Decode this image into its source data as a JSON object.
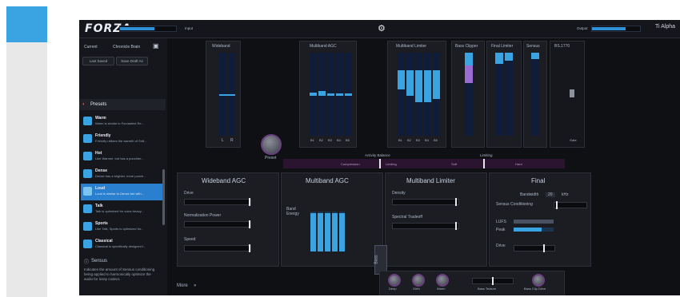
{
  "app": {
    "logo": "FORZA",
    "brand": "Ti Alpha",
    "input_label": "Input",
    "output_label": "Output",
    "input_level": 0.62,
    "output_level": 0.7
  },
  "sidebar": {
    "current_label": "Current",
    "current_value": "Chronicle Brain",
    "chips": [
      "Last Saved",
      "Save Draft As"
    ],
    "presets_label": "Presets",
    "presets": [
      {
        "title": "Warm",
        "desc": "Warm is similar to Forzastrict Re..."
      },
      {
        "title": "Friendly",
        "desc": "Friendly utilizes the warmth of Soft..."
      },
      {
        "title": "Hot",
        "desc": "Like Warmer, but has a punchier..."
      },
      {
        "title": "Dense",
        "desc": "Dense has a brighter, more punch..."
      },
      {
        "title": "Loud",
        "desc": "Loud is similar to Dense but with..."
      },
      {
        "title": "Talk",
        "desc": "Talk is optimized for voice-heavy..."
      },
      {
        "title": "Sports",
        "desc": "Like Talk, Sports is optimized for..."
      },
      {
        "title": "Classical",
        "desc": "Classical is specifically designed f..."
      }
    ],
    "selected_index": 4,
    "sensus_title": "Sensus",
    "sensus_desc": "Indicates the amount of Sensus conditioning being applied to harmonically optimize the audio for lossy codecs."
  },
  "meters": {
    "wideband": {
      "title": "Wideband",
      "labels": [
        "L",
        "R"
      ]
    },
    "multiband_agc": {
      "title": "Multiband AGC",
      "labels": [
        "B1",
        "B2",
        "B3",
        "B4",
        "B5"
      ]
    },
    "multiband_limiter": {
      "title": "Multiband Limiter",
      "labels": [
        "B1",
        "B2",
        "B3",
        "B4",
        "B5"
      ]
    },
    "bass_clipper": {
      "title": "Bass Clipper"
    },
    "final_limiter": {
      "title": "Final Limiter"
    },
    "sensus": {
      "title": "Sensus"
    },
    "bs1770": {
      "title": "BS.1770",
      "gate": "Gate"
    }
  },
  "center": {
    "preset_knob_label": "Preset",
    "activity_balance": "Activity Balance",
    "limiting": "Limiting",
    "compression": "Compression",
    "limiting2": "Limiting",
    "soft": "Soft",
    "hard": "Hard"
  },
  "sections": {
    "wideband_agc": {
      "title": "Wideband AGC",
      "drive": "Drive",
      "norm": "Normalization Power",
      "speed": "Speed"
    },
    "multiband_agc": {
      "title": "Multiband AGC",
      "band_energy": "Band Energy"
    },
    "multiband_limiter": {
      "title": "Multiband Limiter",
      "density": "Density",
      "spectral": "Spectral Tradeoff"
    },
    "final": {
      "title": "Final",
      "bandwidth_label": "Bandwidth",
      "bandwidth_value": "20",
      "bandwidth_unit": "kHz",
      "sensus_label": "Sensus Conditioning",
      "lufs_label": "LUFS",
      "peak_label": "Peak",
      "drive_label": "Drive"
    }
  },
  "bass": {
    "tab": "Bass",
    "knobs": [
      "Deep",
      "Girth",
      "Warm",
      "Bass Texture",
      "Bass Clip Drive"
    ]
  },
  "more": "More"
}
